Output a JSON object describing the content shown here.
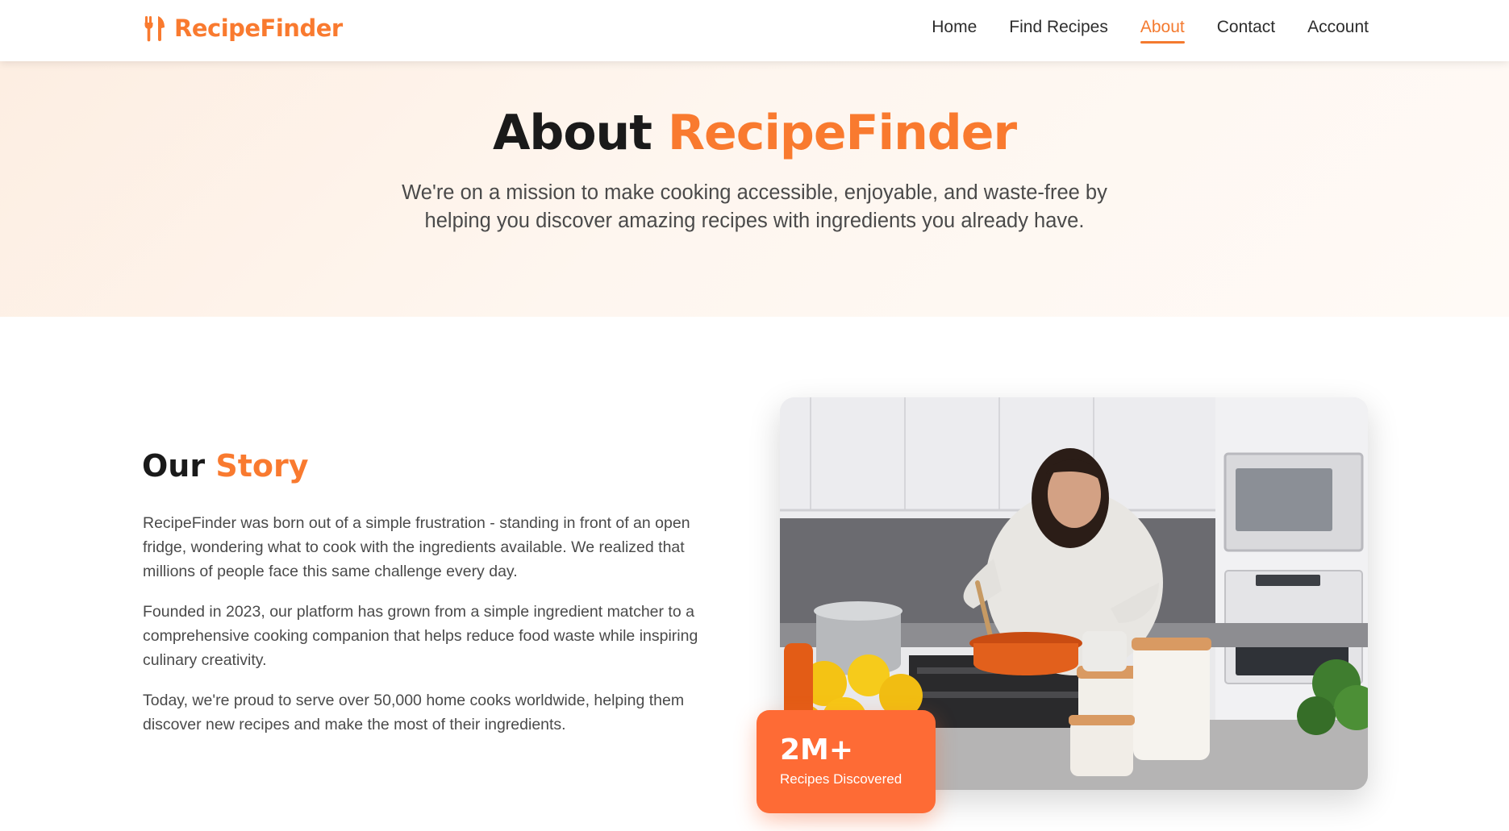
{
  "header": {
    "brand": "RecipeFinder",
    "brand_icon": "fork-knife-icon",
    "nav": [
      {
        "label": "Home",
        "active": false
      },
      {
        "label": "Find Recipes",
        "active": false
      },
      {
        "label": "About",
        "active": true
      },
      {
        "label": "Contact",
        "active": false
      },
      {
        "label": "Account",
        "active": false
      }
    ]
  },
  "hero": {
    "title_prefix": "About",
    "title_accent": "RecipeFinder",
    "subtitle": "We're on a mission to make cooking accessible, enjoyable, and waste-free by helping you discover amazing recipes with ingredients you already have."
  },
  "story": {
    "title_prefix": "Our",
    "title_accent": "Story",
    "paragraphs": [
      "RecipeFinder was born out of a simple frustration - standing in front of an open fridge, wondering what to cook with the ingredients available. We realized that millions of people face this same challenge every day.",
      "Founded in 2023, our platform has grown from a simple ingredient matcher to a comprehensive cooking companion that helps reduce food waste while inspiring culinary creativity.",
      "Today, we're proud to serve over 50,000 home cooks worldwide, helping them discover new recipes and make the most of their ingredients."
    ]
  },
  "stat": {
    "value": "2M+",
    "label": "Recipes Discovered"
  },
  "colors": {
    "accent": "#f97a2f",
    "badge": "#fe6b35",
    "text_dark": "#1a1a1a",
    "text_body": "#4a4a4a"
  }
}
